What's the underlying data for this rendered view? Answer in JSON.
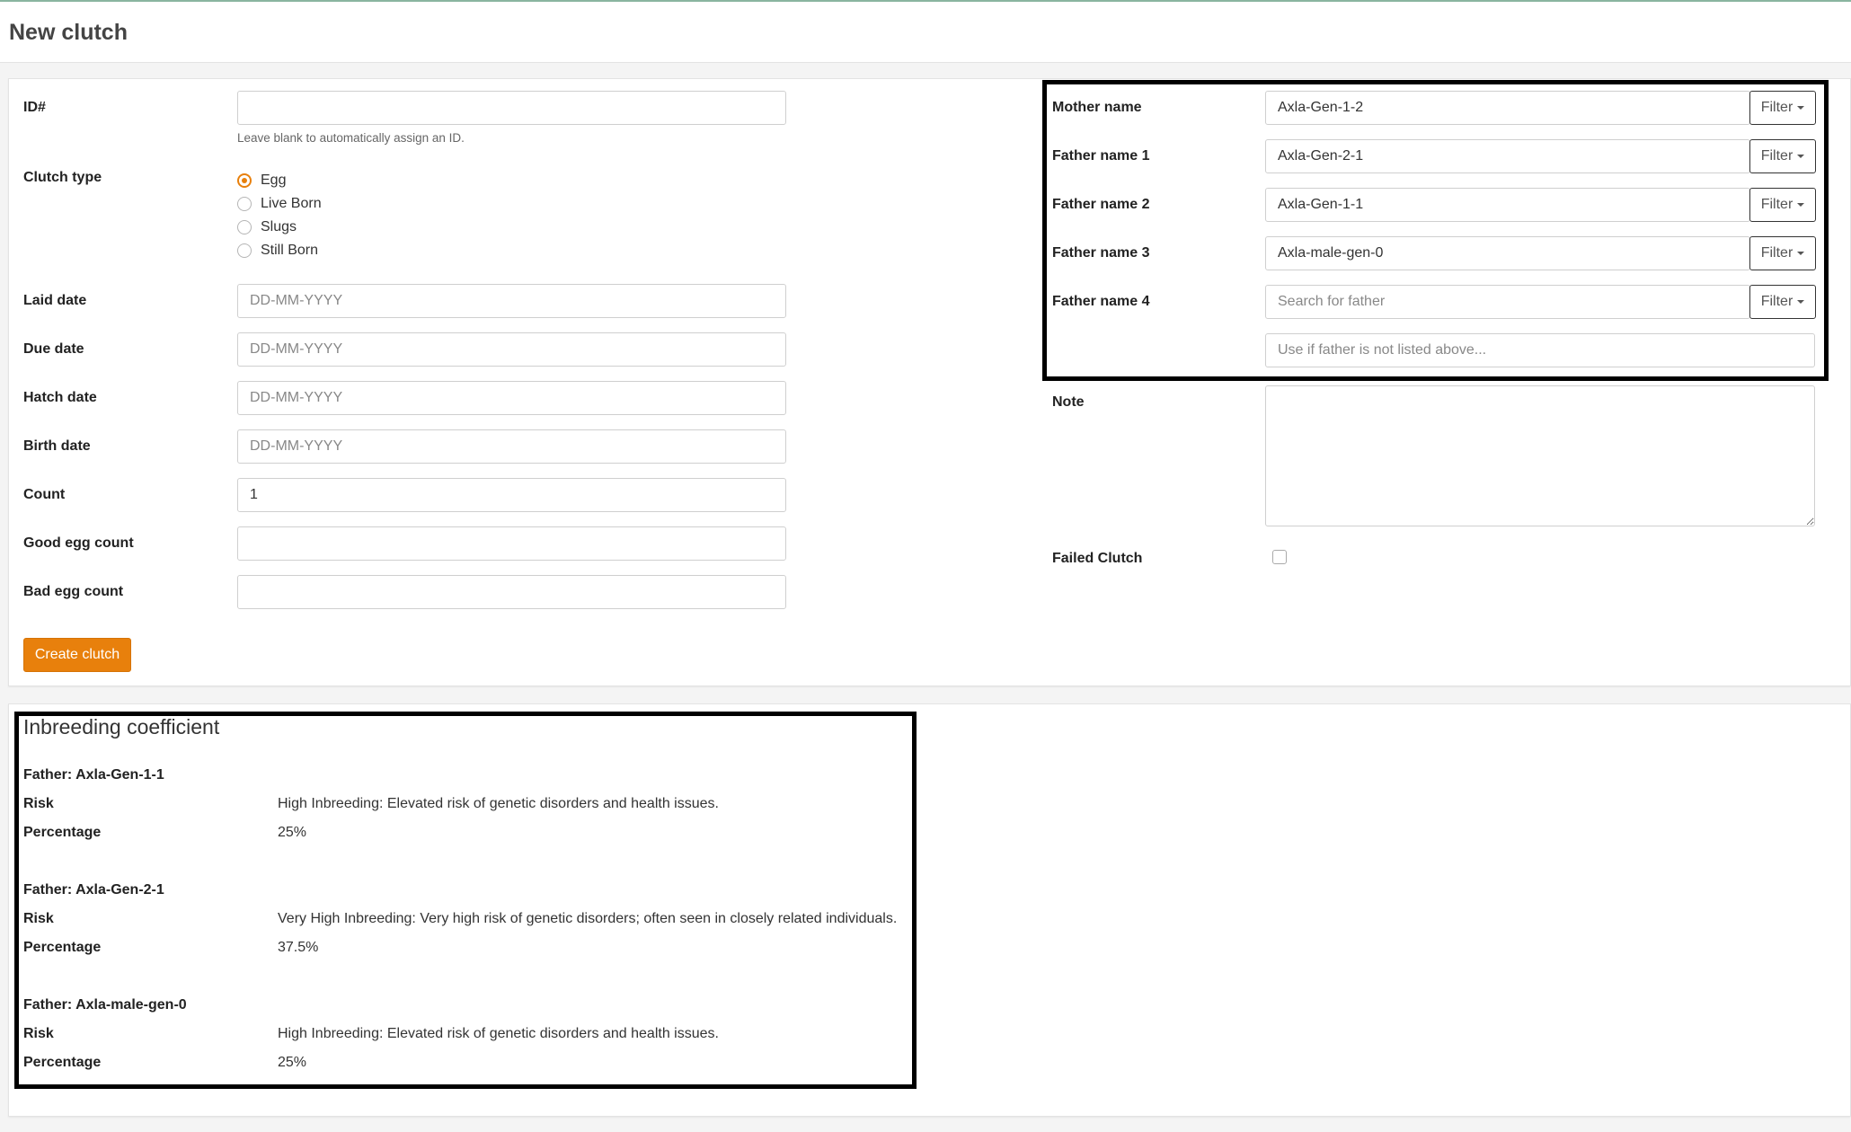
{
  "page": {
    "title": "New clutch"
  },
  "form": {
    "id": {
      "label": "ID#",
      "value": "",
      "help": "Leave blank to automatically assign an ID."
    },
    "clutch_type": {
      "label": "Clutch type",
      "options": [
        "Egg",
        "Live Born",
        "Slugs",
        "Still Born"
      ],
      "selected": "Egg"
    },
    "laid_date": {
      "label": "Laid date",
      "placeholder": "DD-MM-YYYY",
      "value": ""
    },
    "due_date": {
      "label": "Due date",
      "placeholder": "DD-MM-YYYY",
      "value": ""
    },
    "hatch_date": {
      "label": "Hatch date",
      "placeholder": "DD-MM-YYYY",
      "value": ""
    },
    "birth_date": {
      "label": "Birth date",
      "placeholder": "DD-MM-YYYY",
      "value": ""
    },
    "count": {
      "label": "Count",
      "value": "1"
    },
    "good_egg_count": {
      "label": "Good egg count",
      "value": ""
    },
    "bad_egg_count": {
      "label": "Bad egg count",
      "value": ""
    },
    "submit_label": "Create clutch",
    "mother": {
      "label": "Mother name",
      "value": "Axla-Gen-1-2"
    },
    "fathers": [
      {
        "label": "Father name 1",
        "value": "Axla-Gen-2-1",
        "placeholder": ""
      },
      {
        "label": "Father name 2",
        "value": "Axla-Gen-1-1",
        "placeholder": ""
      },
      {
        "label": "Father name 3",
        "value": "Axla-male-gen-0",
        "placeholder": ""
      },
      {
        "label": "Father name 4",
        "value": "",
        "placeholder": "Search for father"
      }
    ],
    "filter_label": "Filter",
    "father_other": {
      "placeholder": "Use if father is not listed above..."
    },
    "note": {
      "label": "Note",
      "value": ""
    },
    "failed_clutch": {
      "label": "Failed Clutch",
      "checked": false
    }
  },
  "inbreeding": {
    "title": "Inbreeding coefficient",
    "risk_label": "Risk",
    "percentage_label": "Percentage",
    "entries": [
      {
        "father": "Father: Axla-Gen-1-1",
        "risk": "High Inbreeding: Elevated risk of genetic disorders and health issues.",
        "percentage": "25%"
      },
      {
        "father": "Father: Axla-Gen-2-1",
        "risk": "Very High Inbreeding: Very high risk of genetic disorders; often seen in closely related individuals.",
        "percentage": "37.5%"
      },
      {
        "father": "Father: Axla-male-gen-0",
        "risk": "High Inbreeding: Elevated risk of genetic disorders and health issues.",
        "percentage": "25%"
      }
    ]
  },
  "colors": {
    "accent": "#e8800c",
    "highlight": "#000000"
  }
}
